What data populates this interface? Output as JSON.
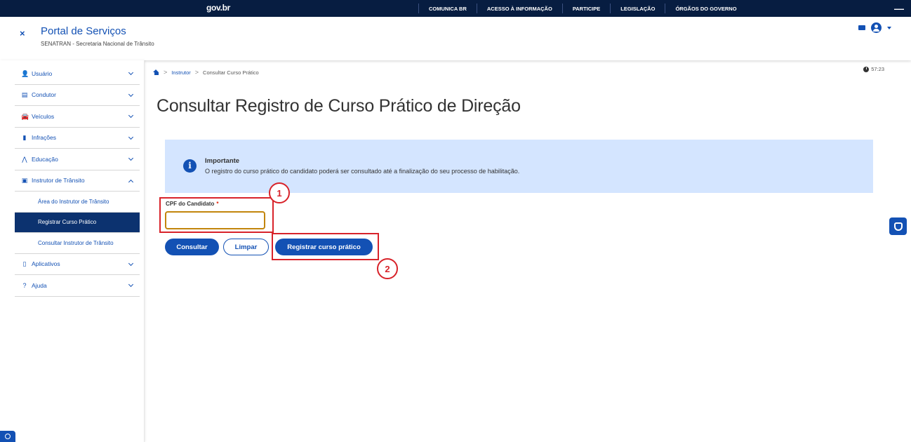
{
  "topbar": {
    "logo": "gov.br",
    "links": [
      "COMUNICA BR",
      "ACESSO À INFORMAÇÃO",
      "PARTICIPE",
      "LEGISLAÇÃO",
      "ÓRGÃOS DO GOVERNO"
    ],
    "minus": "—"
  },
  "header": {
    "close": "×",
    "title": "Portal de Serviços",
    "subtitle": "SENATRAN - Secretaria Nacional de Trânsito"
  },
  "sidebar": {
    "items": [
      {
        "label": "Usuário",
        "icon": "user-icon",
        "glyph": "👤"
      },
      {
        "label": "Condutor",
        "icon": "id-card-icon",
        "glyph": "▤"
      },
      {
        "label": "Veículos",
        "icon": "car-icon",
        "glyph": "🚘"
      },
      {
        "label": "Infrações",
        "icon": "document-icon",
        "glyph": "▮"
      },
      {
        "label": "Educação",
        "icon": "road-icon",
        "glyph": "⋀"
      },
      {
        "label": "Instrutor de Trânsito",
        "icon": "instructor-icon",
        "glyph": "▣"
      },
      {
        "label": "Aplicativos",
        "icon": "mobile-icon",
        "glyph": "▯"
      },
      {
        "label": "Ajuda",
        "icon": "help-icon",
        "glyph": "?"
      }
    ],
    "subitems": [
      "Área do Instrutor de Trânsito",
      "Registrar Curso Prático",
      "Consultar Instrutor de Trânsito"
    ]
  },
  "breadcrumb": {
    "arrow": ">",
    "link": "Instrutor",
    "current": "Consultar Curso Prático"
  },
  "timer": "57:23",
  "page": {
    "title": "Consultar Registro de Curso Prático de Direção"
  },
  "alert": {
    "icon": "i",
    "title": "Importante",
    "text": "O registro do curso prático do candidato poderá ser consultado até a finalização do seu processo de habilitação."
  },
  "form": {
    "cpf_label": "CPF do Candidato",
    "required": "*",
    "cpf_value": ""
  },
  "buttons": {
    "consultar": "Consultar",
    "limpar": "Limpar",
    "registrar": "Registrar curso prático"
  },
  "annotations": [
    "1",
    "2"
  ],
  "colors": {
    "topbar": "#071d41",
    "primary": "#1351b4",
    "active_menu": "#0c326f",
    "alert_bg": "#d4e5ff",
    "annotation": "#d8232a",
    "input_border": "#c2850c"
  }
}
